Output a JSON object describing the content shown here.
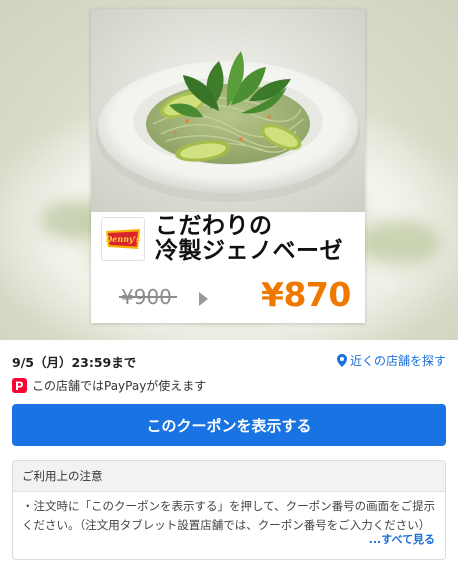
{
  "hero": {
    "brand_logo_text": "Denny's",
    "dish_name_line1": "こだわりの",
    "dish_name_line2": "冷製ジェノベーゼ",
    "old_price": "¥900",
    "new_price": "¥870"
  },
  "info": {
    "expiry": "9/5（月）23:59まで",
    "nearby_link": "近くの店舗を探す",
    "paypay_note": "この店舗ではPayPayが使えます"
  },
  "coupon_button": {
    "label": "このクーポンを表示する"
  },
  "notice": {
    "title": "ご利用上の注意",
    "body": "・注文時に「このクーポンを表示する」を押して、クーポン番号の画面をご提示ください。（注文用タブレット設置店舗では、クーポン番号をご入力ください）",
    "see_all": "...すべて見る"
  },
  "colors": {
    "accent_blue": "#1a73e3",
    "link_blue": "#1a6fd9",
    "price_orange": "#f07800",
    "paypay_red": "#ff0033"
  },
  "icons": {
    "location": "location-pin-icon",
    "paypay": "paypay-icon",
    "arrow": "price-arrow-icon"
  }
}
